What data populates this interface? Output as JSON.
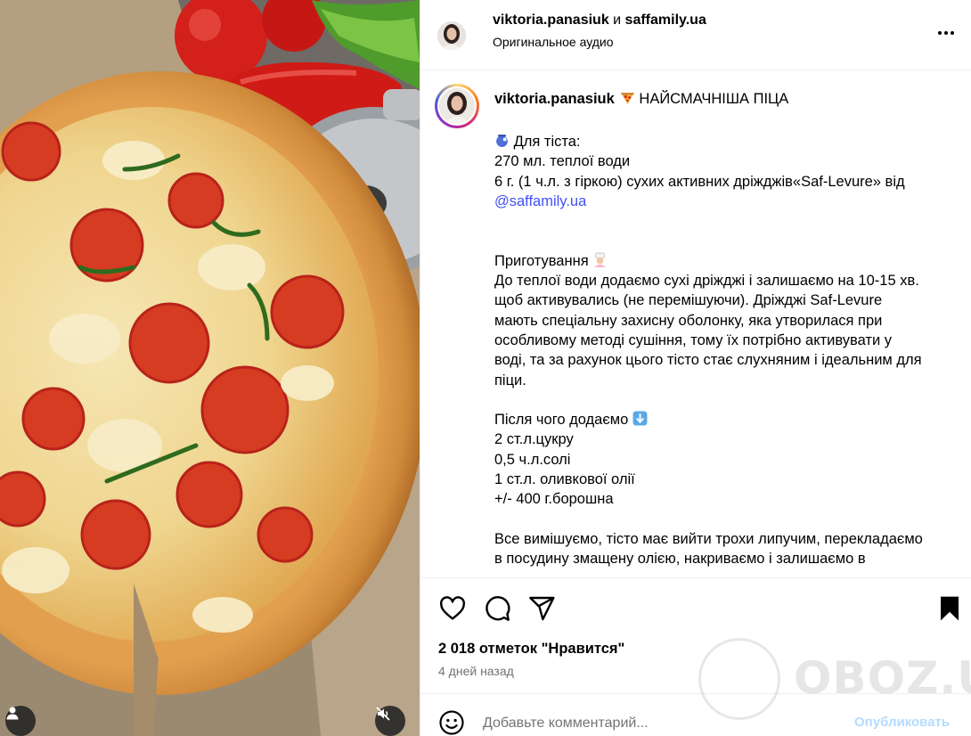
{
  "header": {
    "user": "viktoria.panasiuk",
    "connector": " и ",
    "collaborator": "saffamily.ua",
    "audio": "Оригинальное аудио"
  },
  "caption": {
    "username": "viktoria.panasiuk",
    "title": "НАЙСМАЧНІША ПІЦА",
    "dough_heading": "Для тіста:",
    "line_water": "270 мл. теплої води",
    "line_yeast": "6 г. (1 ч.л. з гіркою) сухих активних дріжджів«Saf-Levure» від",
    "mention": "@saffamily.ua",
    "prep_heading": "Приготування",
    "prep_1": "До теплої води додаємо сухі дріжджі і залишаємо на 10-15 хв.",
    "prep_2": "щоб активувались (не перемішуючи). Дріжджі Saf-Levure",
    "prep_3": "мають спеціальну захисну оболонку, яка утворилася при",
    "prep_4": "особливому методі сушіння, тому їх потрібно активувати у",
    "prep_5": "воді, та за рахунок цього тісто стає слухняним і ідеальним для",
    "prep_6": "піци.",
    "after_heading": "Після чого додаємо",
    "ing_1": "2 ст.л.цукру",
    "ing_2": "0,5 ч.л.солі",
    "ing_3": "1 ст.л. оливкової олії",
    "ing_4": "+/- 400 г.борошна",
    "mix_1": "Все вимішуємо, тісто має вийти трохи липучим, перекладаємо",
    "mix_2": "в посудину змащену олією, накриваємо і залишаємо в"
  },
  "stats": {
    "likes_count": "2 018",
    "likes_label": "отметок \"Нравится\"",
    "time_ago": "4 дней назад"
  },
  "comment": {
    "placeholder": "Добавьте комментарий...",
    "post_label": "Опубликовать"
  },
  "watermark": {
    "text": "OBOZ.UA"
  },
  "icons": {
    "like": "heart-icon",
    "comment": "comment-icon",
    "share": "paper-plane-icon",
    "save": "bookmark-icon",
    "more": "more-dots-icon",
    "emoji": "smiley-icon",
    "tag": "user-tag-icon",
    "mute": "audio-muted-icon"
  },
  "colors": {
    "mention": "#4150f7",
    "post_button": "#b3dbff",
    "secondary_text": "#737373",
    "divider": "#efefef"
  }
}
